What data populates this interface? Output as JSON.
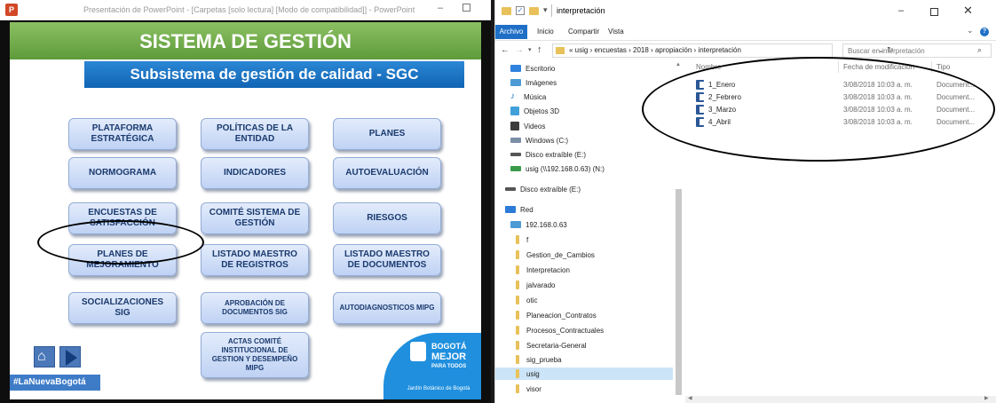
{
  "powerpoint": {
    "logo": "P",
    "window_title": "Presentación de PowerPoint - [Carpetas [solo lectura] [Modo de compatibilidad]] - PowerPoint",
    "minimize": "–",
    "slide": {
      "title": "SISTEMA DE GESTIÓN",
      "subtitle": "Subsistema de gestión de calidad - SGC",
      "buttons": [
        {
          "label": "PLATAFORMA ESTRATÉGICA"
        },
        {
          "label": "POLÍTICAS DE LA ENTIDAD"
        },
        {
          "label": "PLANES"
        },
        {
          "label": "NORMOGRAMA"
        },
        {
          "label": "INDICADORES"
        },
        {
          "label": "AUTOEVALUACIÓN"
        },
        {
          "label": "ENCUESTAS DE SATISFACCIÓN"
        },
        {
          "label": "COMITÉ SISTEMA DE GESTIÓN"
        },
        {
          "label": "RIESGOS"
        },
        {
          "label": "PLANES DE MEJORAMIENTO"
        },
        {
          "label": "LISTADO MAESTRO DE REGISTROS"
        },
        {
          "label": "LISTADO MAESTRO DE DOCUMENTOS"
        },
        {
          "label": "SOCIALIZACIONES SIG"
        },
        {
          "label": "APROBACIÓN DE DOCUMENTOS SIG"
        },
        {
          "label": "AUTODIAGNOSTICOS MIPG"
        },
        {
          "label": "ACTAS COMITÉ INSTITUCIONAL DE GESTION Y DESEMPEÑO MIPG"
        }
      ],
      "hashtag": "#LaNuevaBogotá",
      "bogota_logo": {
        "line1": "BOGOTÁ",
        "line2": "MEJOR",
        "line3": "PARA TODOS",
        "footer": "Jardín Botánico de Bogotá"
      }
    }
  },
  "explorer": {
    "window_title": "interpretación",
    "controls": {
      "minimize": "–",
      "close": "✕"
    },
    "ribbon": {
      "tabs": [
        "Archivo",
        "Inicio",
        "Compartir",
        "Vista"
      ],
      "help": "?"
    },
    "address": {
      "crumbs": "« usig › encuestas › 2018 › apropiación › interpretación",
      "search_placeholder": "Buscar en interpretación"
    },
    "nav_items": [
      {
        "label": "Escritorio",
        "icon": "desktop-icon"
      },
      {
        "label": "Imágenes",
        "icon": "pictures-icon"
      },
      {
        "label": "Música",
        "icon": "music-icon"
      },
      {
        "label": "Objetos 3D",
        "icon": "objects-3d-icon"
      },
      {
        "label": "Videos",
        "icon": "videos-icon"
      },
      {
        "label": "Windows (C:)",
        "icon": "drive-icon"
      },
      {
        "label": "Disco extraíble (E:)",
        "icon": "usb-drive-icon"
      },
      {
        "label": "usig (\\\\192.168.0.63) (N:)",
        "icon": "network-drive-icon"
      },
      {
        "label": "Disco extraíble (E:)",
        "icon": "usb-drive-icon"
      },
      {
        "label": "Red",
        "icon": "network-icon"
      },
      {
        "label": "192.168.0.63",
        "icon": "computer-icon"
      },
      {
        "label": "f",
        "icon": "folder-icon"
      },
      {
        "label": "Gestion_de_Cambios",
        "icon": "folder-icon"
      },
      {
        "label": "Interpretacion",
        "icon": "folder-icon"
      },
      {
        "label": "jalvarado",
        "icon": "folder-icon"
      },
      {
        "label": "otic",
        "icon": "folder-icon"
      },
      {
        "label": "Planeacion_Contratos",
        "icon": "folder-icon"
      },
      {
        "label": "Procesos_Contractuales",
        "icon": "folder-icon"
      },
      {
        "label": "Secretaria-General",
        "icon": "folder-icon"
      },
      {
        "label": "sig_prueba",
        "icon": "folder-icon"
      },
      {
        "label": "usig",
        "icon": "folder-icon",
        "selected": true
      },
      {
        "label": "visor",
        "icon": "folder-icon"
      }
    ],
    "columns": [
      "Nombre",
      "Fecha de modificación",
      "Tipo"
    ],
    "files": [
      {
        "name": "1_Enero",
        "date": "3/08/2018 10:03 a. m.",
        "type": "Document..."
      },
      {
        "name": "2_Febrero",
        "date": "3/08/2018 10:03 a. m.",
        "type": "Document..."
      },
      {
        "name": "3_Marzo",
        "date": "3/08/2018 10:03 a. m.",
        "type": "Document..."
      },
      {
        "name": "4_Abril",
        "date": "3/08/2018 10:03 a. m.",
        "type": "Document..."
      }
    ]
  }
}
